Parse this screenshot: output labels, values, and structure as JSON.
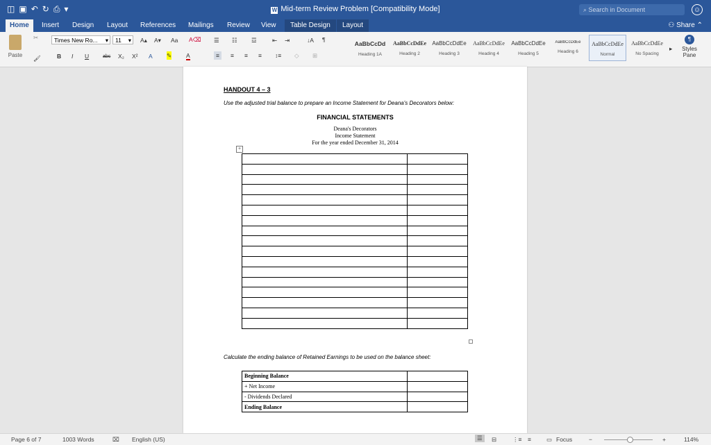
{
  "window": {
    "title": "Mid-term Review Problem [Compatibility Mode]",
    "search_placeholder": "Search in Document"
  },
  "tabs": [
    "Home",
    "Insert",
    "Design",
    "Layout",
    "References",
    "Mailings",
    "Review",
    "View",
    "Table Design",
    "Layout"
  ],
  "share_label": "Share",
  "ribbon": {
    "paste_label": "Paste",
    "font_name": "Times New Ro...",
    "font_size": "11",
    "bold": "B",
    "italic": "I",
    "underline": "U",
    "strike": "abc",
    "styles": [
      {
        "sample": "AaBbCcDd",
        "name": "Heading 1A"
      },
      {
        "sample": "AaBbCcDdEe",
        "name": "Heading 2"
      },
      {
        "sample": "AaBbCcDdEe",
        "name": "Heading 3"
      },
      {
        "sample": "AaBbCcDdEe",
        "name": "Heading 4"
      },
      {
        "sample": "AaBbCcDdEe",
        "name": "Heading 5"
      },
      {
        "sample": "AaBbCcDdEe",
        "name": "Heading 6"
      },
      {
        "sample": "AaBbCcDdEe",
        "name": "Normal"
      },
      {
        "sample": "AaBbCcDdEe",
        "name": "No Spacing"
      }
    ],
    "styles_pane_label": "Styles Pane"
  },
  "document": {
    "handout": "HANDOUT 4 – 3",
    "instruction": "Use the adjusted trial balance to prepare an Income Statement for Deana's Decorators below:",
    "heading": "FINANCIAL STATEMENTS",
    "company": "Deana's Decorators",
    "statement": "Income Statement",
    "period": "For the year ended December 31, 2014",
    "calc_instruction": "Calculate the ending balance of Retained Earnings to be used on the balance sheet:",
    "re_rows": [
      "Beginning Balance",
      "+ Net Income",
      "- Dividends Declared",
      "Ending Balance"
    ]
  },
  "status": {
    "page": "Page 6 of 7",
    "words": "1003 Words",
    "language": "English (US)",
    "focus": "Focus",
    "zoom": "114%"
  }
}
